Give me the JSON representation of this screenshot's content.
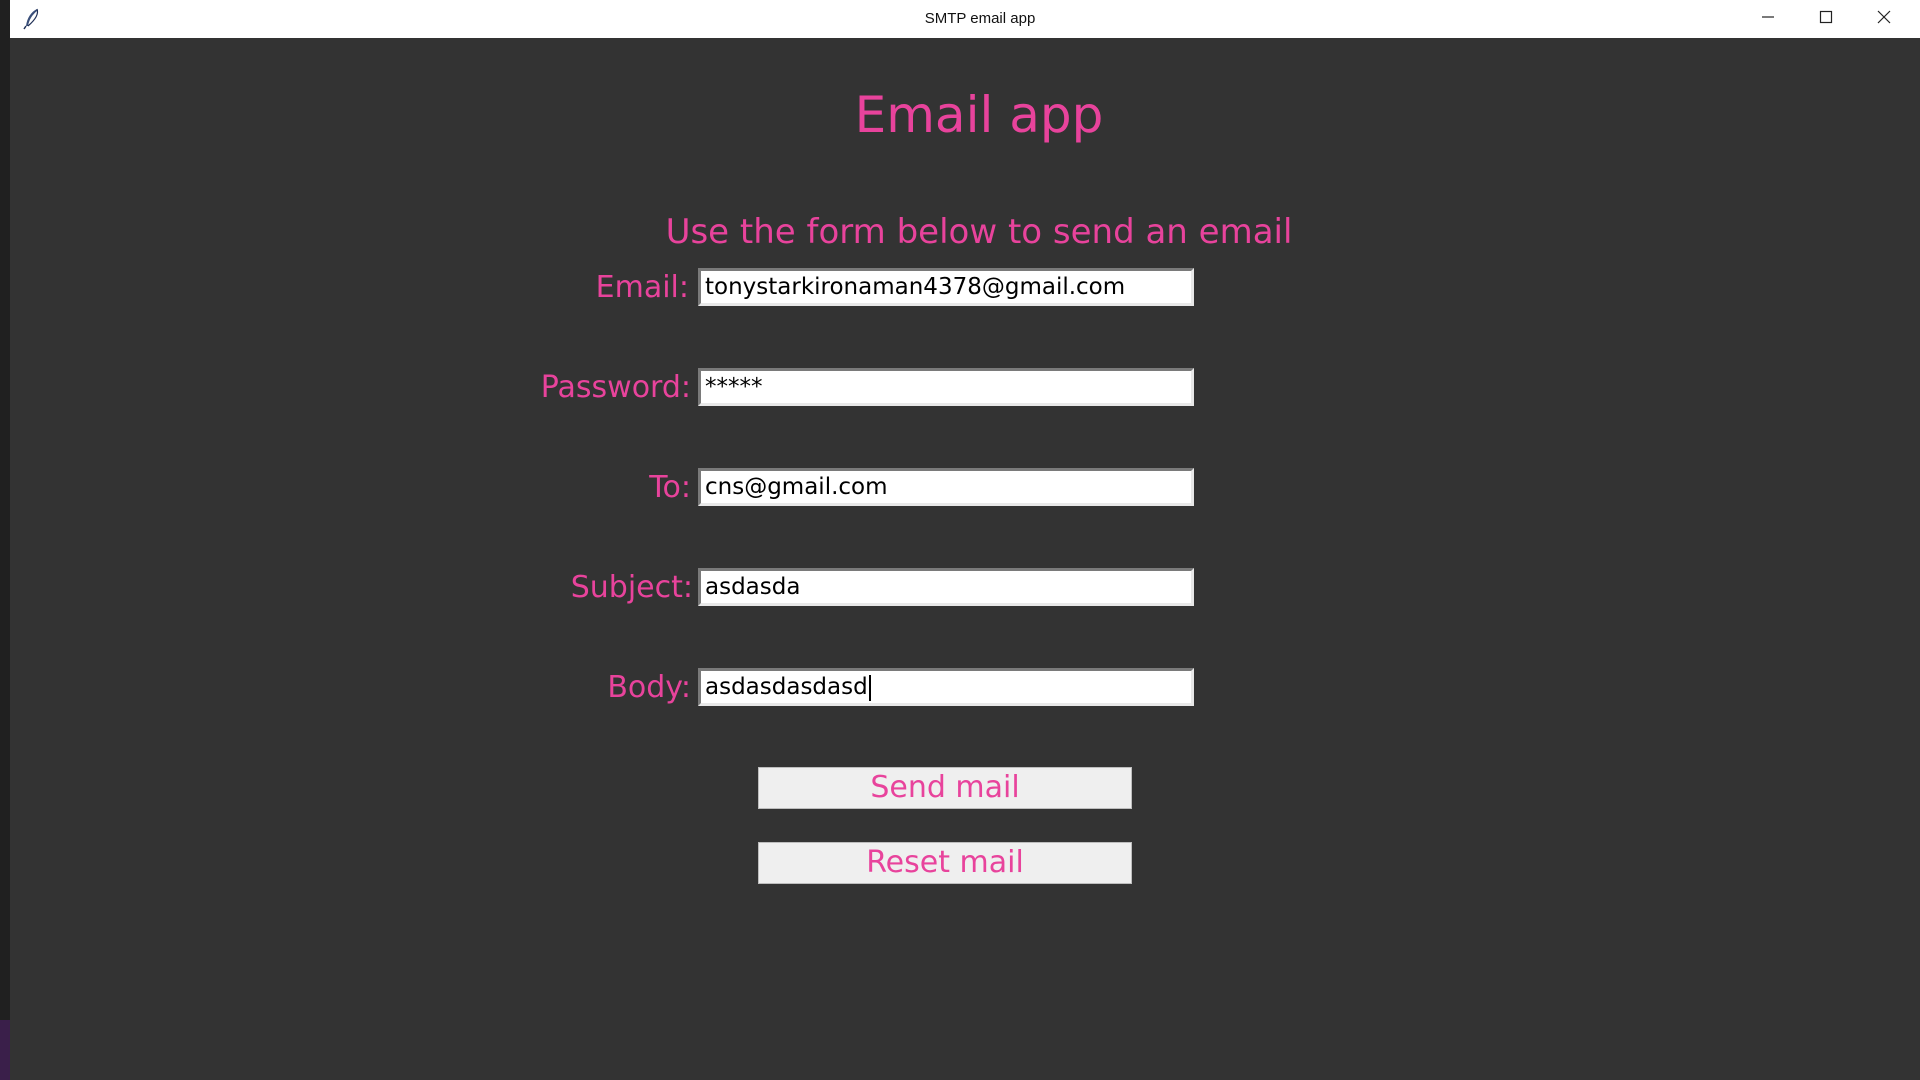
{
  "window": {
    "title": "SMTP email app",
    "controls": {
      "minimize_icon": "minimize-icon",
      "maximize_icon": "maximize-icon",
      "close_icon": "close-icon"
    }
  },
  "app": {
    "heading": "Email app",
    "subheading": "Use the form below to send an email",
    "accent_color": "#e8439c",
    "background_color": "#333333"
  },
  "form": {
    "email": {
      "label": "Email:",
      "value": "tonystarkironaman4378@gmail.com"
    },
    "password": {
      "label": "Password:",
      "value": "*****"
    },
    "to": {
      "label": "To:",
      "value": "cns@gmail.com"
    },
    "subject": {
      "label": "Subject:",
      "value": "asdasda"
    },
    "body": {
      "label": "Body:",
      "value": "asdasdasdasd"
    }
  },
  "buttons": {
    "send": "Send mail",
    "reset": "Reset mail"
  }
}
